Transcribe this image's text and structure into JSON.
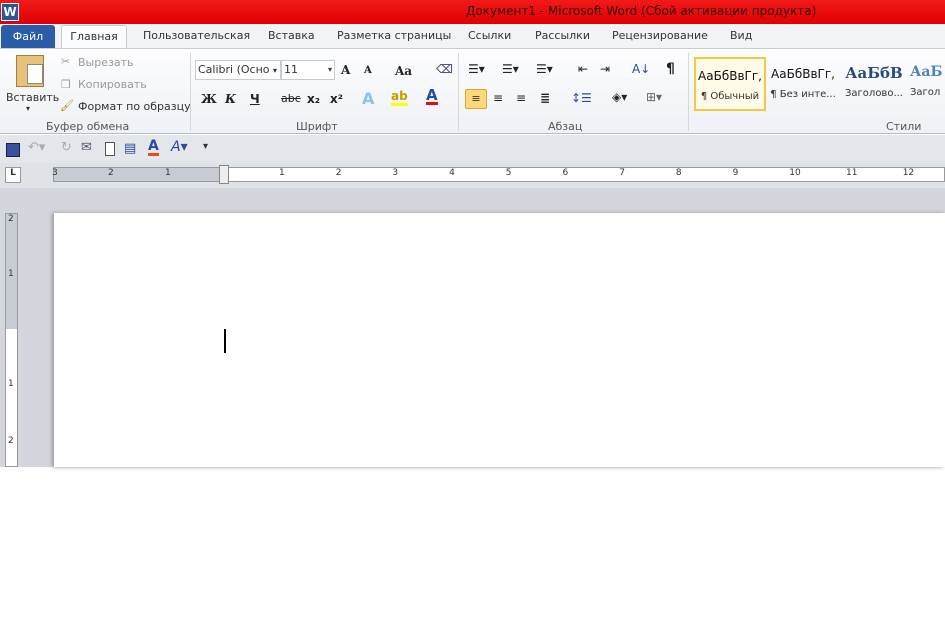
{
  "window": {
    "title": "Документ1  -  Microsoft Word (Сбой активации продукта)",
    "logo": "W"
  },
  "tabs": [
    "Файл",
    "Главная",
    "Пользовательская",
    "Вставка",
    "Разметка страницы",
    "Ссылки",
    "Рассылки",
    "Рецензирование",
    "Вид"
  ],
  "clipboard": {
    "paste": "Вставить",
    "cut": "Вырезать",
    "copy": "Копировать",
    "format_painter": "Формат по образцу",
    "label": "Буфер обмена"
  },
  "font": {
    "name": "Calibri (Осно",
    "size": "11",
    "label": "Шрифт",
    "bold": "Ж",
    "italic": "К",
    "underline": "Ч",
    "strike": "abc",
    "sub": "x₂",
    "sup": "x²",
    "grow": "A",
    "shrink": "A",
    "case": "Aa",
    "color": "A",
    "effects": "A"
  },
  "paragraph": {
    "label": "Абзац",
    "pilcrow": "¶"
  },
  "styles": {
    "label": "Стили",
    "items": [
      {
        "sample": "АаБбВвГг,",
        "name": "¶ Обычный"
      },
      {
        "sample": "АаБбВвГг,",
        "name": "¶ Без инте..."
      },
      {
        "sample": "АаБбВ",
        "name": "Заголово..."
      },
      {
        "sample": "АаБ",
        "name": "Загол"
      }
    ]
  },
  "ruler": {
    "left": [
      "3",
      "2",
      "1"
    ],
    "right": [
      "1",
      "2",
      "3",
      "4",
      "5",
      "6",
      "7",
      "8",
      "9",
      "10",
      "11",
      "12"
    ],
    "vertical": [
      "2",
      "1",
      "1",
      "2"
    ]
  },
  "colors": {
    "title": "#e00000",
    "file_tab": "#2a5ca8",
    "accent": "#f5c842"
  }
}
